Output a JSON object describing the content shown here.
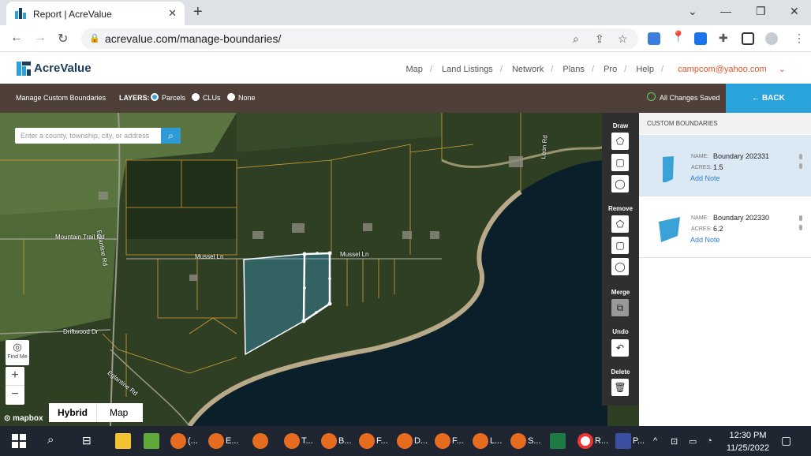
{
  "browser": {
    "tab_title": "Report | AcreValue",
    "url": "acrevalue.com/manage-boundaries/"
  },
  "site": {
    "logo": "AcreValue",
    "nav": [
      "Map",
      "Land Listings",
      "Network",
      "Plans",
      "Pro",
      "Help"
    ],
    "user": "campcom@yahoo.com"
  },
  "toolbar": {
    "title": "Manage Custom Boundaries",
    "layers_label": "LAYERS:",
    "layers": [
      {
        "label": "Parcels",
        "selected": true
      },
      {
        "label": "CLUs",
        "selected": false
      },
      {
        "label": "None",
        "selected": false
      }
    ],
    "status": "All Changes Saved",
    "back": "BACK"
  },
  "map": {
    "search_placeholder": "Enter a county, township, city, or address",
    "roads": [
      "Mountain Trail Rd",
      "Mussel Ln",
      "Mussel Ln",
      "Driftwood Dr",
      "Eglantine Rd",
      "Eglantine Rd",
      "Leon Rd"
    ],
    "find_me": "Find Me",
    "zoom_in": "+",
    "zoom_out": "−",
    "attribution": "mapbox",
    "style_options": [
      "Hybrid",
      "Map"
    ],
    "active_style": "Hybrid"
  },
  "tools": {
    "draw": "Draw",
    "remove": "Remove",
    "merge": "Merge",
    "undo": "Undo",
    "delete": "Delete"
  },
  "panel": {
    "header": "CUSTOM BOUNDARIES",
    "name_label": "NAME:",
    "acres_label": "ACRES:",
    "note_label": "Add Note",
    "boundaries": [
      {
        "name": "Boundary 202331",
        "acres": "1.5",
        "selected": true
      },
      {
        "name": "Boundary 202330",
        "acres": "6.2",
        "selected": false
      }
    ]
  },
  "taskbar": {
    "items": [
      "(...",
      "E...",
      "",
      "T...",
      "B...",
      "F...",
      "D...",
      "F...",
      "L...",
      "S...",
      "",
      "R...",
      "P..."
    ],
    "time": "12:30 PM",
    "date": "11/25/2022"
  },
  "colors": {
    "accent": "#29a3d9",
    "toolbar": "#4e4039",
    "selected_card": "#dbe9f5",
    "boundary_fill": "#3aa2d6"
  }
}
